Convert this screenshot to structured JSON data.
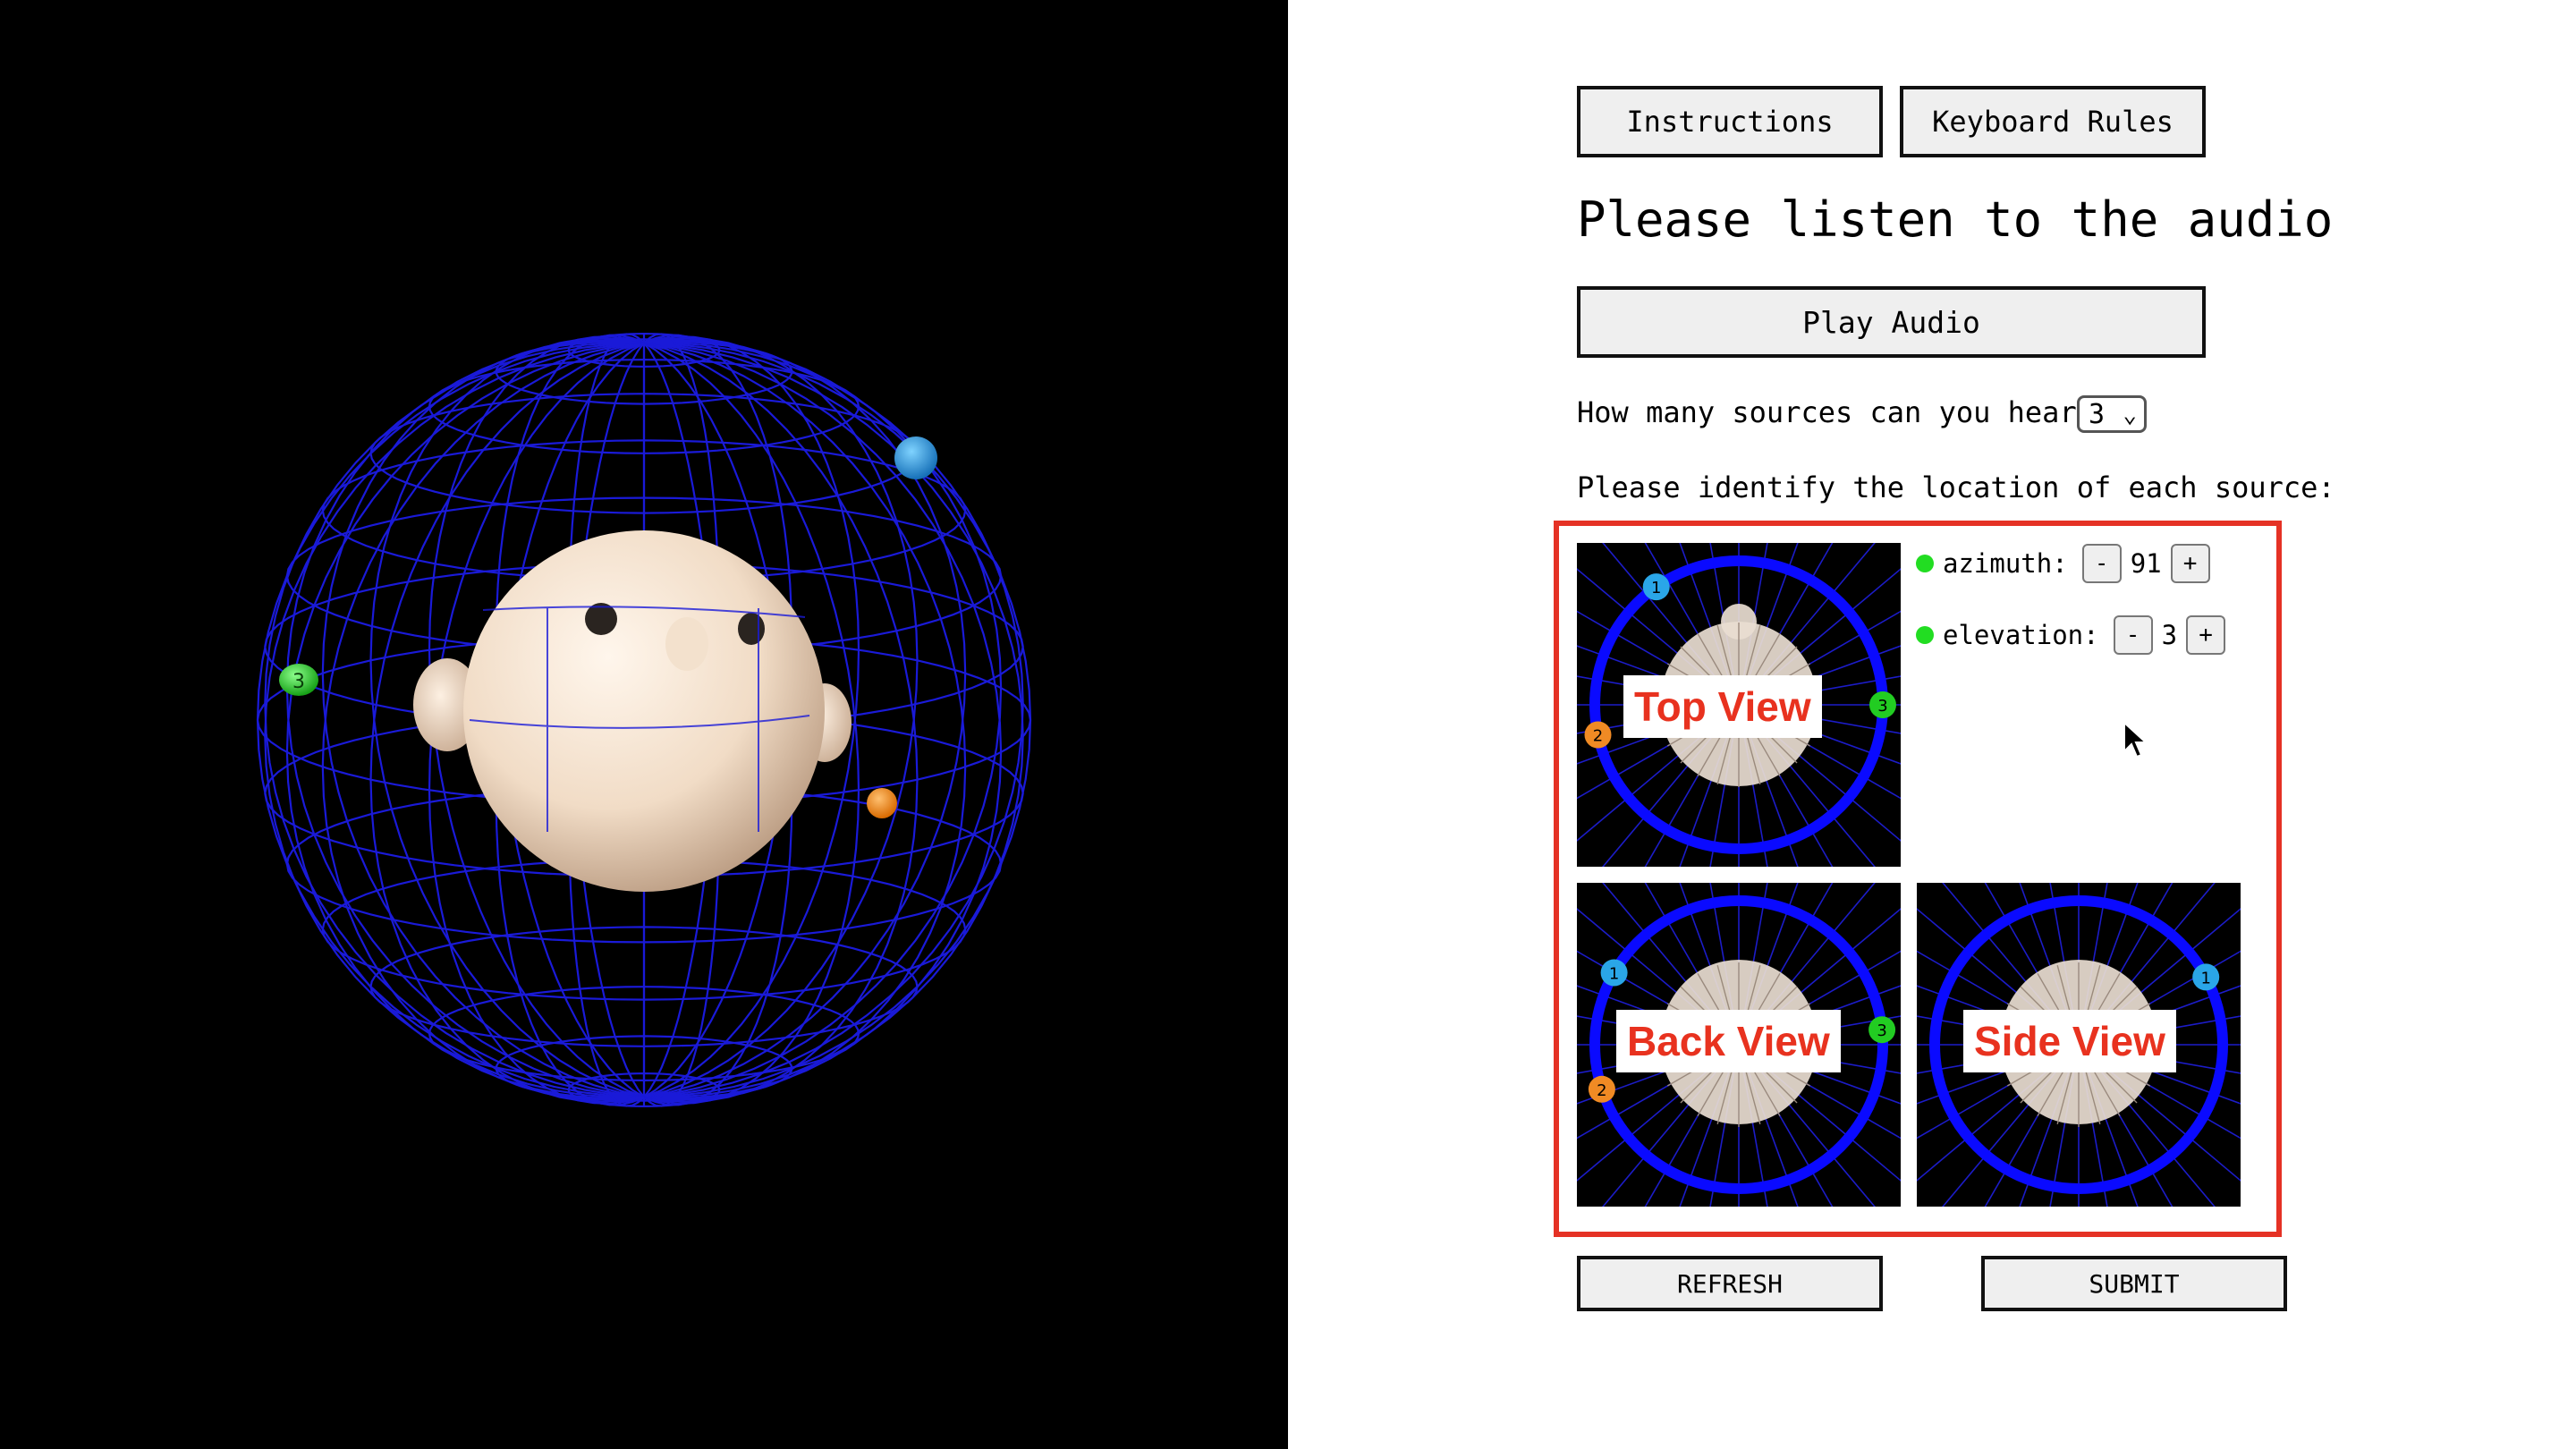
{
  "toolbar": {
    "instructions_label": "Instructions",
    "keyboard_rules_label": "Keyboard Rules"
  },
  "main": {
    "heading": "Please listen to the audio",
    "play_label": "Play Audio",
    "sources_question": "How many sources can you hear?",
    "sources_selected": "3",
    "locate_prompt": "Please identify the location of each source:"
  },
  "controls": {
    "azimuth": {
      "label": "azimuth:",
      "minus": "-",
      "value": "91",
      "plus": "+"
    },
    "elevation": {
      "label": "elevation:",
      "minus": "-",
      "value": "3",
      "plus": "+"
    },
    "active_source_color": "#22dd22"
  },
  "views": {
    "top": "Top View",
    "back": "Back View",
    "side": "Side View"
  },
  "sources": [
    {
      "number": "1",
      "color": "#2aa6e8"
    },
    {
      "number": "2",
      "color": "#f08a24"
    },
    {
      "number": "3",
      "color": "#22cc22"
    }
  ],
  "footer": {
    "refresh_label": "REFRESH",
    "submit_label": "SUBMIT"
  },
  "colors": {
    "highlight_border": "#e53225",
    "wireframe": "#1a1ad8",
    "view_ring": "#0a0aff",
    "label_red": "#e8321f"
  }
}
